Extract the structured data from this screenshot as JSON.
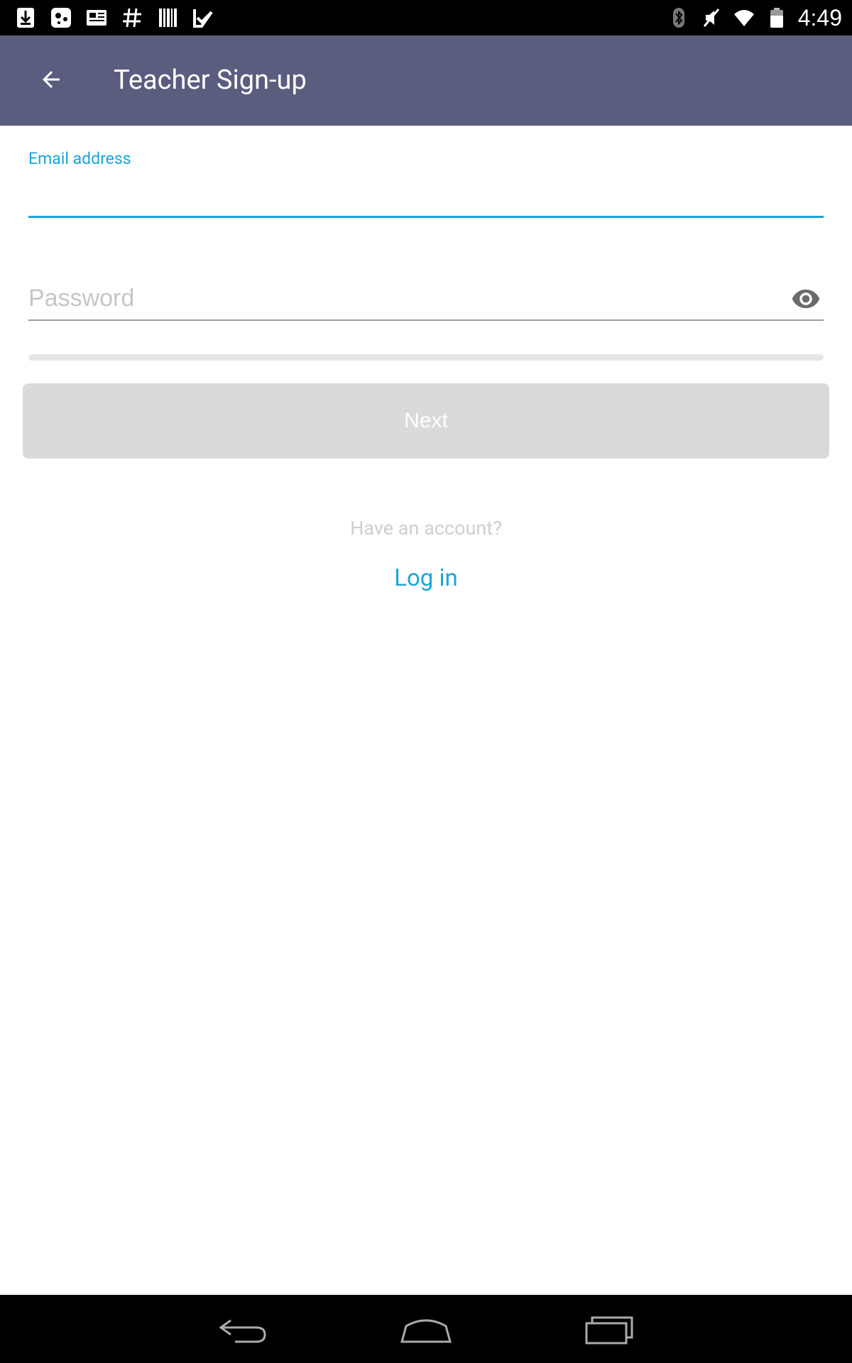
{
  "status_bar": {
    "time": "4:49",
    "left_icons": [
      "download-icon",
      "game-controller-icon",
      "news-icon",
      "hashtag-icon",
      "barcode-icon",
      "checklist-icon"
    ],
    "right_icons": [
      "bluetooth-icon",
      "muted-icon",
      "wifi-icon",
      "battery-icon"
    ]
  },
  "app_bar": {
    "title": "Teacher Sign-up",
    "back_icon": "arrow-left-icon",
    "color": "#5a5d7d"
  },
  "form": {
    "email_label": "Email address",
    "email_value": "",
    "password_placeholder": "Password",
    "password_value": "",
    "toggle_icon": "eye-icon",
    "next_label": "Next",
    "accent_color": "#1aa5d8"
  },
  "footer": {
    "have_account_text": "Have an account?",
    "login_label": "Log in"
  },
  "nav_bar": {
    "buttons": [
      "back-icon",
      "home-icon",
      "recents-icon"
    ]
  }
}
